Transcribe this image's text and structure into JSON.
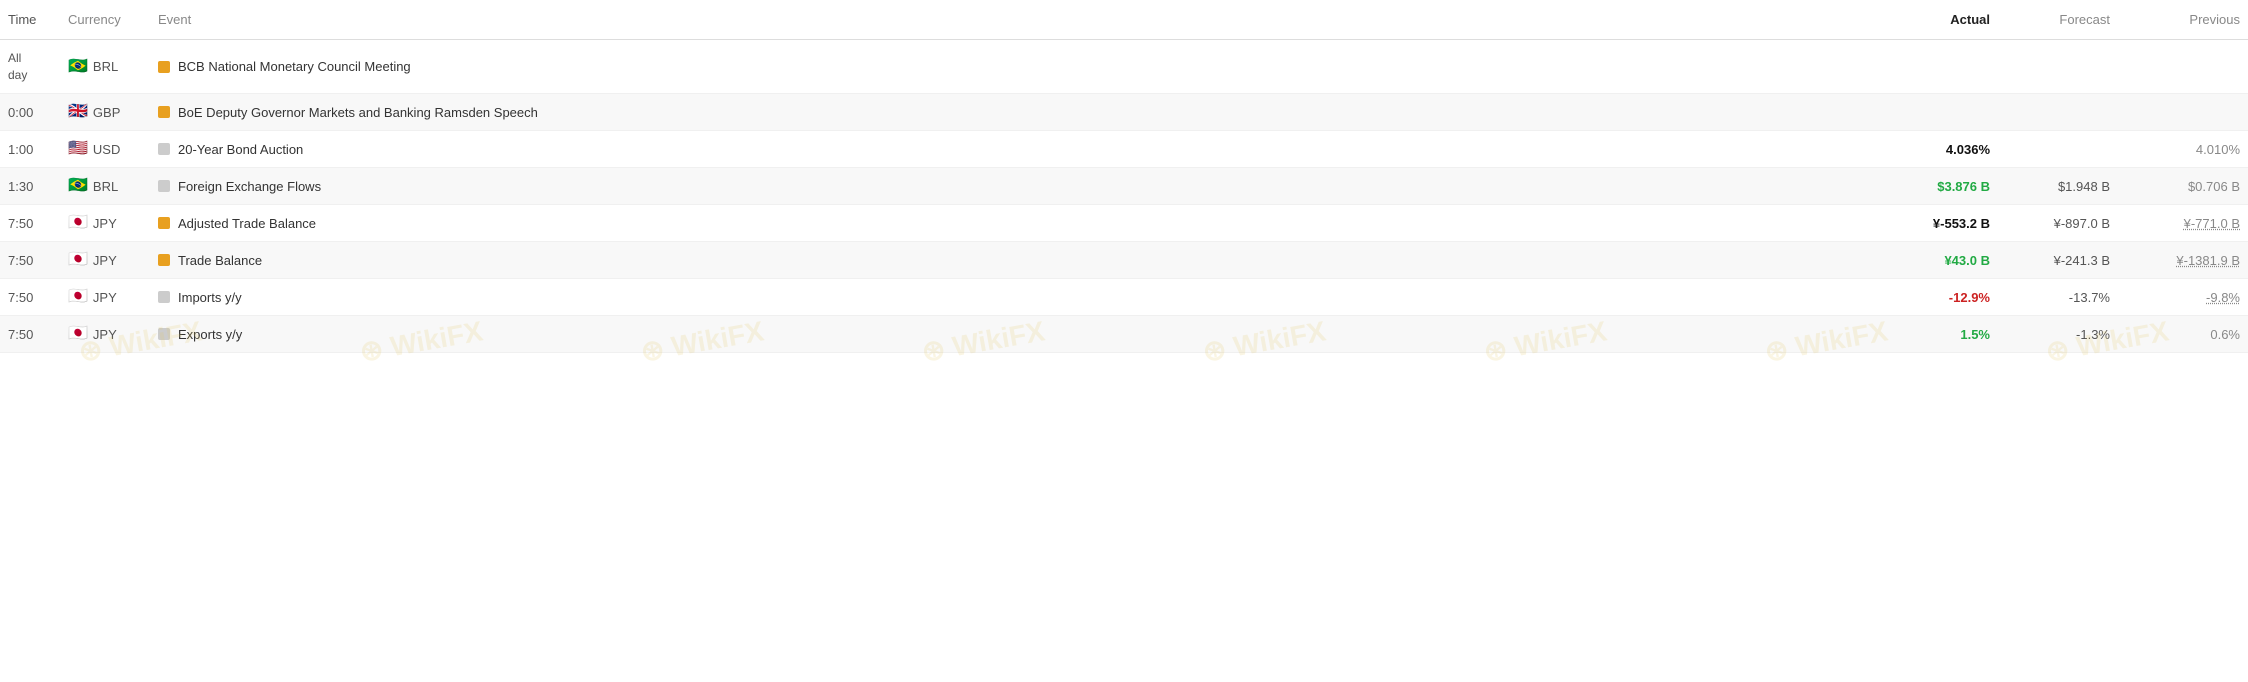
{
  "header": {
    "col_time": "Time",
    "col_currency": "Currency",
    "col_event": "Event",
    "col_actual": "Actual",
    "col_forecast": "Forecast",
    "col_previous": "Previous"
  },
  "rows": [
    {
      "time": "All\nday",
      "time_type": "allday",
      "flag": "🇧🇷",
      "currency": "BRL",
      "importance": "high",
      "event": "BCB National Monetary Council Meeting",
      "actual": "",
      "actual_type": "neutral",
      "forecast": "",
      "previous": ""
    },
    {
      "time": "0:00",
      "time_type": "normal",
      "flag": "🇬🇧",
      "currency": "GBP",
      "importance": "high",
      "event": "BoE Deputy Governor Markets and Banking Ramsden Speech",
      "actual": "",
      "actual_type": "neutral",
      "forecast": "",
      "previous": ""
    },
    {
      "time": "1:00",
      "time_type": "normal",
      "flag": "🇺🇸",
      "currency": "USD",
      "importance": "low",
      "event": "20-Year Bond Auction",
      "actual": "4.036%",
      "actual_type": "black",
      "forecast": "",
      "previous": "4.010%",
      "previous_style": "normal"
    },
    {
      "time": "1:30",
      "time_type": "normal",
      "flag": "🇧🇷",
      "currency": "BRL",
      "importance": "low",
      "event": "Foreign Exchange Flows",
      "actual": "$3.876 B",
      "actual_type": "green",
      "forecast": "$1.948 B",
      "previous": "$0.706 B",
      "previous_style": "normal"
    },
    {
      "time": "7:50",
      "time_type": "normal",
      "flag": "🇯🇵",
      "currency": "JPY",
      "importance": "high",
      "event": "Adjusted Trade Balance",
      "actual": "¥-553.2 B",
      "actual_type": "black",
      "forecast": "¥-897.0 B",
      "previous": "¥-771.0 B",
      "previous_style": "dotted"
    },
    {
      "time": "7:50",
      "time_type": "normal",
      "flag": "🇯🇵",
      "currency": "JPY",
      "importance": "high",
      "event": "Trade Balance",
      "actual": "¥43.0 B",
      "actual_type": "green",
      "forecast": "¥-241.3 B",
      "previous": "¥-1381.9 B",
      "previous_style": "dotted"
    },
    {
      "time": "7:50",
      "time_type": "normal",
      "flag": "🇯🇵",
      "currency": "JPY",
      "importance": "low",
      "event": "Imports y/y",
      "actual": "-12.9%",
      "actual_type": "red",
      "forecast": "-13.7%",
      "previous": "-9.8%",
      "previous_style": "dotted"
    },
    {
      "time": "7:50",
      "time_type": "normal",
      "flag": "🇯🇵",
      "currency": "JPY",
      "importance": "low",
      "event": "Exports y/y",
      "actual": "1.5%",
      "actual_type": "green",
      "forecast": "-1.3%",
      "previous": "0.6%",
      "previous_style": "normal"
    }
  ]
}
